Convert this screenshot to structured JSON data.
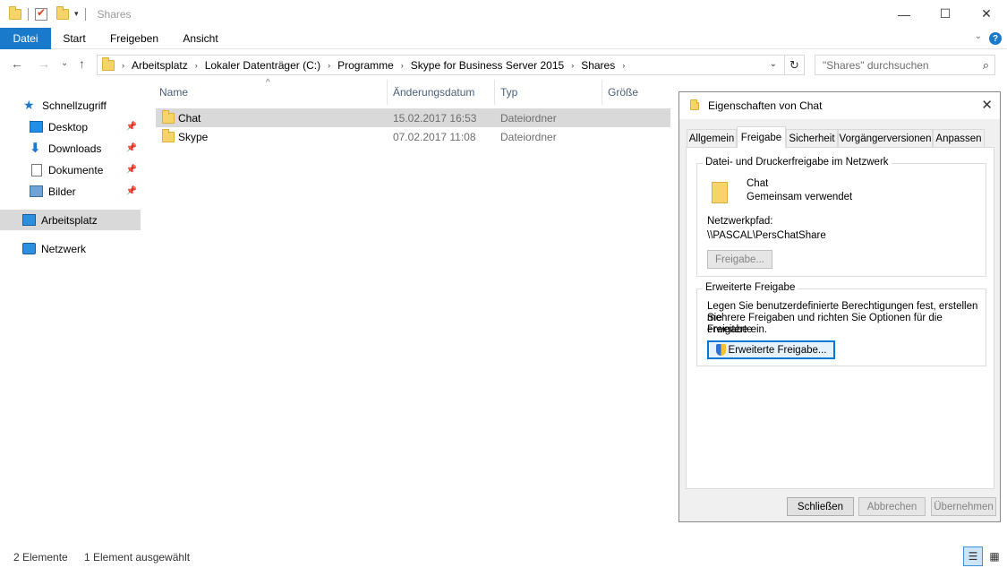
{
  "window": {
    "title": "Shares",
    "minimize": "—",
    "maximize": "☐",
    "close": "✕"
  },
  "ribbon": {
    "tabs": [
      {
        "label": "Datei"
      },
      {
        "label": "Start"
      },
      {
        "label": "Freigeben"
      },
      {
        "label": "Ansicht"
      }
    ],
    "help": "?",
    "collapse": "⌄"
  },
  "nav": {
    "back": "←",
    "forward": "→",
    "recent": "⌄",
    "up": "↑"
  },
  "address": {
    "crumbs": [
      "Arbeitsplatz",
      "Lokaler Datenträger (C:)",
      "Programme",
      "Skype for Business Server 2015",
      "Shares"
    ],
    "separator": "›",
    "dropdown": "⌄",
    "refresh": "↻"
  },
  "search": {
    "placeholder": "\"Shares\" durchsuchen",
    "icon": "search-icon"
  },
  "sidebar": {
    "items": [
      {
        "label": "Schnellzugriff",
        "icon": "star-icon"
      },
      {
        "label": "Desktop",
        "icon": "desktop-icon",
        "pinned": true
      },
      {
        "label": "Downloads",
        "icon": "download-icon",
        "pinned": true
      },
      {
        "label": "Dokumente",
        "icon": "documents-icon",
        "pinned": true
      },
      {
        "label": "Bilder",
        "icon": "pictures-icon",
        "pinned": true
      },
      {
        "label": "Arbeitsplatz",
        "icon": "computer-icon",
        "selected": true
      },
      {
        "label": "Netzwerk",
        "icon": "network-icon"
      }
    ],
    "pin_glyph": "📌"
  },
  "filelist": {
    "columns": [
      {
        "label": "Name"
      },
      {
        "label": "Änderungsdatum"
      },
      {
        "label": "Typ"
      },
      {
        "label": "Größe"
      }
    ],
    "sort_indicator": "^",
    "rows": [
      {
        "name": "Chat",
        "modified": "15.02.2017 16:53",
        "type": "Dateiordner",
        "size": "",
        "selected": true
      },
      {
        "name": "Skype",
        "modified": "07.02.2017 11:08",
        "type": "Dateiordner",
        "size": "",
        "selected": false
      }
    ]
  },
  "dialog": {
    "title": "Eigenschaften von Chat",
    "close": "✕",
    "tabs": [
      {
        "label": "Allgemein"
      },
      {
        "label": "Freigabe",
        "active": true
      },
      {
        "label": "Sicherheit"
      },
      {
        "label": "Vorgängerversionen"
      },
      {
        "label": "Anpassen"
      }
    ],
    "network_group": {
      "title": "Datei- und Druckerfreigabe im Netzwerk",
      "folder_name": "Chat",
      "folder_status": "Gemeinsam verwendet",
      "path_label": "Netzwerkpfad:",
      "path_value": "\\\\PASCAL\\PersChatShare",
      "share_button": "Freigabe..."
    },
    "advanced_group": {
      "title": "Erweiterte Freigabe",
      "description_lines": [
        "Legen Sie benutzerdefinierte Berechtigungen fest, erstellen Sie",
        "mehrere Freigaben und richten Sie Optionen für die erweiterte",
        "Freigabe ein."
      ],
      "button": "Erweiterte Freigabe..."
    },
    "buttons": {
      "close": "Schließen",
      "cancel": "Abbrechen",
      "apply": "Übernehmen"
    }
  },
  "statusbar": {
    "items_count": "2 Elemente",
    "selected_count": "1 Element ausgewählt",
    "details_view": "☰",
    "icons_view": "▦"
  }
}
